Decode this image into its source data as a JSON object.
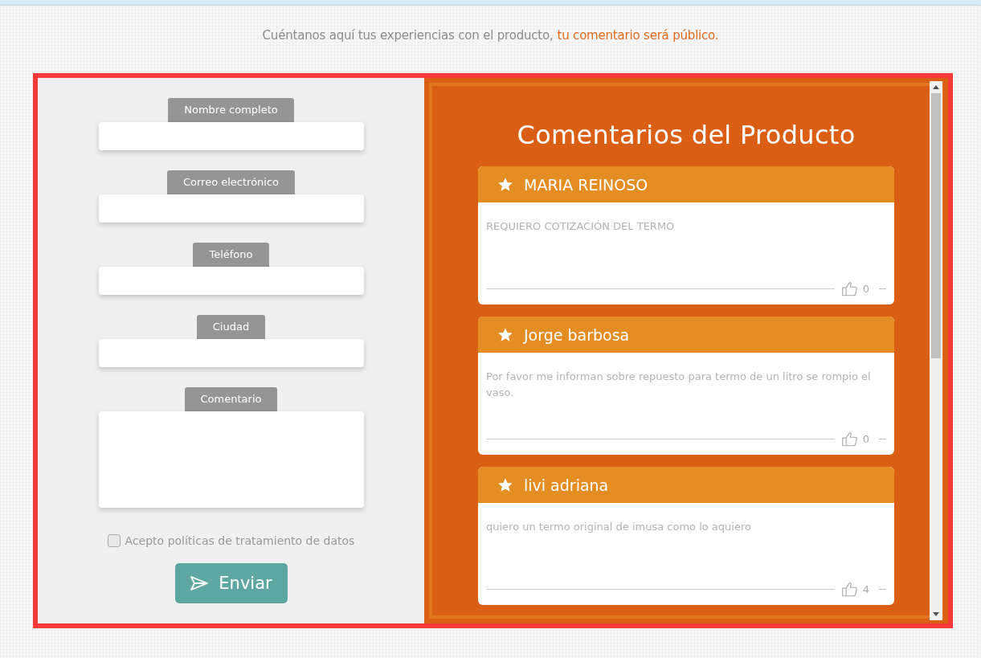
{
  "intro": {
    "text": "Cuéntanos aquí tus experiencias con el producto,",
    "highlight": "tu comentario será público."
  },
  "form": {
    "fields": [
      {
        "label": "Nombre completo",
        "kind": "input"
      },
      {
        "label": "Correo electrónico",
        "kind": "input"
      },
      {
        "label": "Teléfono",
        "kind": "input"
      },
      {
        "label": "Ciudad",
        "kind": "input"
      },
      {
        "label": "Comentario",
        "kind": "textarea"
      }
    ],
    "consent": {
      "label": "Acepto políticas de tratamiento de datos",
      "checked": false
    },
    "submit": "Enviar"
  },
  "comments_panel": {
    "title": "Comentarios del Producto",
    "comments": [
      {
        "author": "MARIA REINOSO",
        "text": "REQUIERO COTIZACIÓN DEL TERMO",
        "likes": "0"
      },
      {
        "author": "Jorge barbosa",
        "text": "Por favor me informan sobre repuesto para termo de un litro se rompio el vaso.",
        "likes": "0"
      },
      {
        "author": "livi adriana",
        "text": "quiero un termo original de imusa como lo aquiero",
        "likes": "4"
      }
    ]
  }
}
